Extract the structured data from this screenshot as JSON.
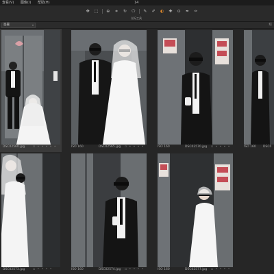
{
  "menu": {
    "items": [
      "查看(V)",
      "图像(I)",
      "帮助(H)"
    ],
    "frame_count": "14"
  },
  "toolbar": {
    "caption": "光标工具",
    "tools": [
      {
        "name": "pan-tool-icon",
        "glyph": "✥"
      },
      {
        "name": "select-tool-icon",
        "glyph": "⬚"
      },
      {
        "name": "loupe-tool-icon",
        "glyph": "⊕"
      },
      {
        "name": "crop-tool-icon",
        "glyph": "⌗"
      },
      {
        "name": "rotate-tool-icon",
        "glyph": "↻"
      },
      {
        "name": "keystone-tool-icon",
        "glyph": "⬠"
      },
      {
        "name": "brush-tool-icon",
        "glyph": "✎"
      },
      {
        "name": "eraser-tool-icon",
        "glyph": "✐"
      },
      {
        "name": "gradient-tool-icon",
        "glyph": "◐"
      },
      {
        "name": "heal-tool-icon",
        "glyph": "✚"
      },
      {
        "name": "clone-tool-icon",
        "glyph": "⊙"
      },
      {
        "name": "picker-tool-icon",
        "glyph": "✒"
      },
      {
        "name": "annotate-tool-icon",
        "glyph": "✑"
      }
    ]
  },
  "subbar": {
    "filter_value": "签署",
    "right_label": "综"
  },
  "photos": [
    {
      "filename": "DSC02560.jpg",
      "iso": "",
      "selected": true
    },
    {
      "filename": "DSC02565.jpg",
      "iso": "ISO 160",
      "selected": false
    },
    {
      "filename": "DSC02570.jpg",
      "iso": "ISO 160",
      "selected": false
    },
    {
      "filename": "DSC0",
      "iso": "ISO 160",
      "selected": false
    },
    {
      "filename": "DSC02573.jpg",
      "iso": "",
      "selected": false
    },
    {
      "filename": "DSC02574.jpg",
      "iso": "ISO 160",
      "selected": false
    },
    {
      "filename": "DSC02577.jpg",
      "iso": "ISO 160",
      "selected": false
    }
  ],
  "colors": {
    "accent": "#e08a2b",
    "background": "#262626",
    "selection": "#3a3a3a"
  }
}
